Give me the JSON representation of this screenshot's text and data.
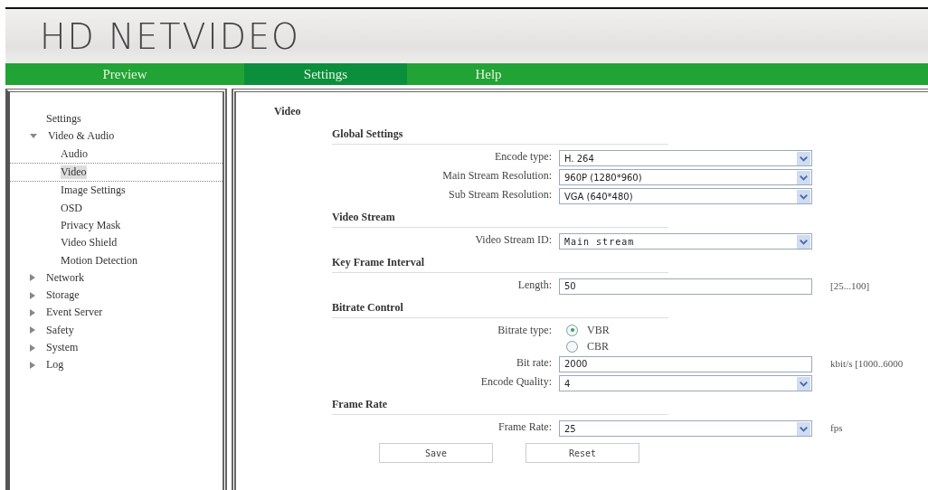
{
  "logo": "HD NETVIDEO",
  "nav": [
    {
      "label": "Preview",
      "selected": false
    },
    {
      "label": "Settings",
      "selected": true
    },
    {
      "label": "Help",
      "selected": false
    }
  ],
  "sidebar": {
    "items": [
      {
        "label": "Settings",
        "kind": "plain"
      },
      {
        "label": "Video & Audio",
        "kind": "group",
        "expanded": true,
        "children": [
          {
            "label": "Audio",
            "selected": false
          },
          {
            "label": "Video",
            "selected": true
          },
          {
            "label": "Image Settings",
            "selected": false
          },
          {
            "label": "OSD",
            "selected": false
          },
          {
            "label": "Privacy Mask",
            "selected": false
          },
          {
            "label": "Video Shield",
            "selected": false
          },
          {
            "label": "Motion Detection",
            "selected": false
          }
        ]
      },
      {
        "label": "Network",
        "kind": "group",
        "expanded": false
      },
      {
        "label": "Storage",
        "kind": "group",
        "expanded": false
      },
      {
        "label": "Event Server",
        "kind": "group",
        "expanded": false
      },
      {
        "label": "Safety",
        "kind": "group",
        "expanded": false
      },
      {
        "label": "System",
        "kind": "group",
        "expanded": false
      },
      {
        "label": "Log",
        "kind": "group",
        "expanded": false
      }
    ]
  },
  "content": {
    "title": "Video",
    "sections": [
      {
        "title": "Global Settings",
        "rows": [
          {
            "kind": "select",
            "label": "Encode type:",
            "value": "H. 264"
          },
          {
            "kind": "select",
            "label": "Main Stream Resolution:",
            "value": "960P (1280*960)"
          },
          {
            "kind": "select",
            "label": "Sub Stream Resolution:",
            "value": "VGA (640*480)"
          }
        ]
      },
      {
        "title": "Video Stream",
        "rows": [
          {
            "kind": "select",
            "label": "Video Stream ID:",
            "value": "Main stream",
            "mono": true
          }
        ]
      },
      {
        "title": "Key Frame Interval",
        "rows": [
          {
            "kind": "text",
            "label": "Length:",
            "value": "50",
            "suffix": "[25...100]"
          }
        ]
      },
      {
        "title": "Bitrate Control",
        "rows": [
          {
            "kind": "radio",
            "label": "Bitrate type:",
            "options": [
              {
                "label": "VBR",
                "selected": true
              },
              {
                "label": "CBR",
                "selected": false
              }
            ]
          },
          {
            "kind": "text",
            "label": "Bit rate:",
            "value": "2000",
            "suffix": "kbit/s  [1000..6000"
          },
          {
            "kind": "select",
            "label": "Encode Quality:",
            "value": "4"
          }
        ]
      },
      {
        "title": "Frame Rate",
        "rows": [
          {
            "kind": "select",
            "label": "Frame Rate:",
            "value": "25",
            "suffix": "fps"
          }
        ]
      }
    ],
    "buttons": [
      "Save",
      "Reset"
    ]
  }
}
